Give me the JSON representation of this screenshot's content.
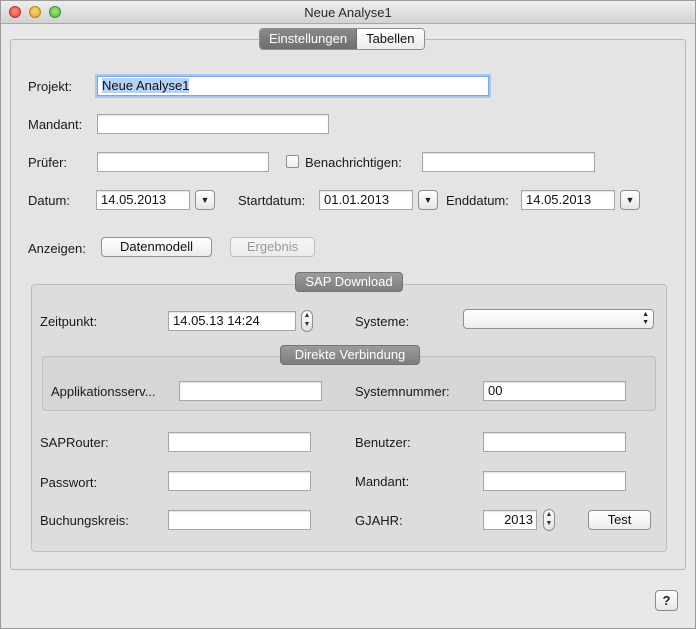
{
  "window": {
    "title": "Neue Analyse1"
  },
  "tabs": [
    "Einstellungen",
    "Tabellen"
  ],
  "form": {
    "projekt_label": "Projekt:",
    "projekt_value": "Neue Analyse1",
    "mandant_label": "Mandant:",
    "mandant_value": "",
    "pruefer_label": "Prüfer:",
    "pruefer_value": "",
    "benachrichtigen_label": "Benachrichtigen:",
    "benachrichtigen_value": "",
    "datum_label": "Datum:",
    "datum_value": "14.05.2013",
    "startdatum_label": "Startdatum:",
    "startdatum_value": "01.01.2013",
    "enddatum_label": "Enddatum:",
    "enddatum_value": "14.05.2013",
    "anzeigen_label": "Anzeigen:",
    "datenmodell_button": "Datenmodell",
    "ergebnis_button": "Ergebnis"
  },
  "sap": {
    "title": "SAP Download",
    "zeitpunkt_label": "Zeitpunkt:",
    "zeitpunkt_value": "14.05.13 14:24",
    "systeme_label": "Systeme:",
    "systeme_value": "",
    "direkt": {
      "title": "Direkte Verbindung",
      "appserver_label": "Applikationsserv...",
      "appserver_value": "",
      "systemnummer_label": "Systemnummer:",
      "systemnummer_value": "00"
    },
    "saprouter_label": "SAPRouter:",
    "saprouter_value": "",
    "benutzer_label": "Benutzer:",
    "benutzer_value": "",
    "passwort_label": "Passwort:",
    "passwort_value": "",
    "mandant_label": "Mandant:",
    "mandant_value": "",
    "buchungskreis_label": "Buchungskreis:",
    "buchungskreis_value": "",
    "gjahr_label": "GJAHR:",
    "gjahr_value": "2013",
    "test_button": "Test"
  },
  "help_button": "?",
  "icons": {
    "date_picker": "chevron-down-icon",
    "stepper": "up-down-arrows-icon",
    "select": "up-down-arrows-icon"
  }
}
